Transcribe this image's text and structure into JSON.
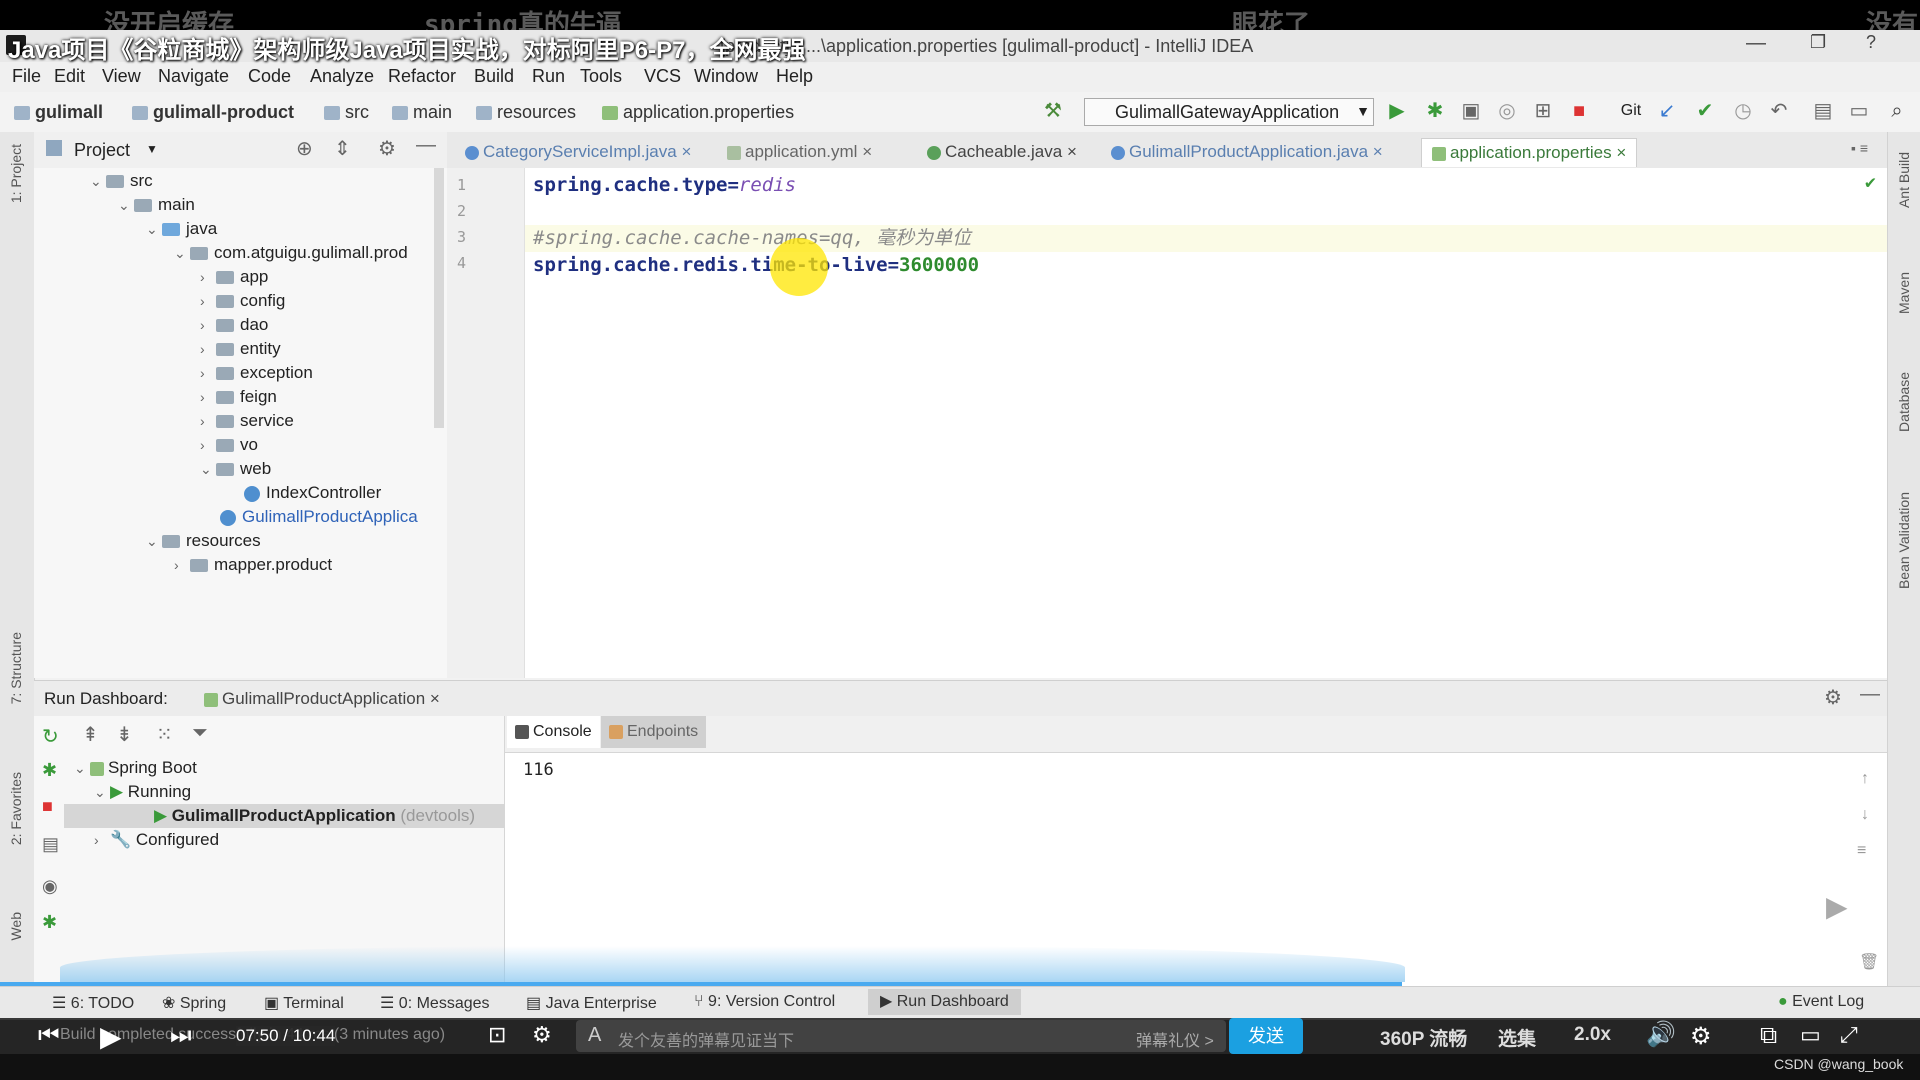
{
  "video": {
    "title": "Java项目《谷粒商城》架构师级Java项目实战，对标阿里P6-P7，全网最强",
    "danmaku": [
      "没开启缓存",
      "spring真的牛逼",
      "眼花了",
      "没有"
    ],
    "time_current": "07:50",
    "time_sep": "/",
    "time_total": "10:44",
    "danmaku_placeholder": "发个友善的弹幕见证当下",
    "etiquette": "弹幕礼仪 >",
    "send": "发送",
    "quality": "360P 流畅",
    "episodes": "选集",
    "speed": "2.0x",
    "watermark": "CSDN @wang_book",
    "progress": 0.73
  },
  "ide": {
    "window_title": "[product] - ...\\application.properties [gulimall-product] - IntelliJ IDEA",
    "menu": [
      "File",
      "Edit",
      "View",
      "Navigate",
      "Code",
      "Analyze",
      "Refactor",
      "Build",
      "Run",
      "Tools",
      "VCS",
      "Window",
      "Help"
    ],
    "breadcrumb": [
      "gulimall",
      "gulimall-product",
      "src",
      "main",
      "resources",
      "application.properties"
    ],
    "run_config": "GulimallGatewayApplication",
    "project_header": "Project",
    "tree": [
      {
        "label": "src",
        "indent": 0,
        "chev": "v"
      },
      {
        "label": "main",
        "indent": 1,
        "chev": "v"
      },
      {
        "label": "java",
        "indent": 2,
        "chev": "v"
      },
      {
        "label": "com.atguigu.gulimall.prod",
        "indent": 3,
        "chev": "v"
      },
      {
        "label": "app",
        "indent": 4,
        "chev": ">"
      },
      {
        "label": "config",
        "indent": 4,
        "chev": ">"
      },
      {
        "label": "dao",
        "indent": 4,
        "chev": ">"
      },
      {
        "label": "entity",
        "indent": 4,
        "chev": ">"
      },
      {
        "label": "exception",
        "indent": 4,
        "chev": ">"
      },
      {
        "label": "feign",
        "indent": 4,
        "chev": ">"
      },
      {
        "label": "service",
        "indent": 4,
        "chev": ">"
      },
      {
        "label": "vo",
        "indent": 4,
        "chev": ">"
      },
      {
        "label": "web",
        "indent": 4,
        "chev": "v"
      },
      {
        "label": "IndexController",
        "indent": 5,
        "chev": ""
      },
      {
        "label": "GulimallProductApplica",
        "indent": 4,
        "chev": ""
      },
      {
        "label": "resources",
        "indent": 2,
        "chev": "v"
      },
      {
        "label": "mapper.product",
        "indent": 3,
        "chev": ">"
      }
    ],
    "tabs": [
      "CategoryServiceImpl.java",
      "application.yml",
      "Cacheable.java",
      "GulimallProductApplication.java",
      "application.properties"
    ],
    "code": {
      "l1_key": "spring.cache.type=",
      "l1_val": "redis",
      "l3_comment": "#spring.cache.cache-names=qq, 毫秒为单位",
      "l4_key": "spring.cache.redis.time-to-live=",
      "l4_val": "3600000"
    },
    "line_numbers": [
      "1",
      "2",
      "3",
      "4"
    ],
    "run_dashboard": {
      "title": "Run Dashboard:",
      "tab": "GulimallProductApplication",
      "tree": {
        "spring_boot": "Spring Boot",
        "running": "Running",
        "app": "GulimallProductApplication",
        "devtools": "(devtools)",
        "configured": "Configured"
      },
      "console_tab": "Console",
      "endpoints_tab": "Endpoints",
      "console_output": "116"
    },
    "bottom_tools": [
      "6: TODO",
      "Spring",
      "Terminal",
      "0: Messages",
      "Java Enterprise",
      "9: Version Control",
      "Run Dashboard"
    ],
    "event_log": "Event Log",
    "status": "Build completed successfully in 44 ms (3 minutes ago)"
  }
}
